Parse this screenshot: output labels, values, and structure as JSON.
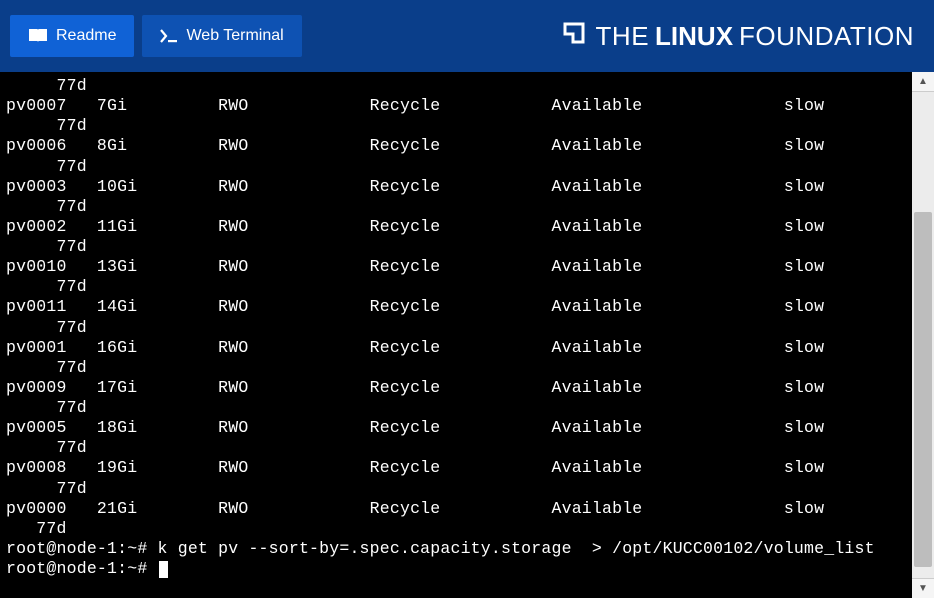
{
  "header": {
    "readme_label": "Readme",
    "webterm_label": "Web Terminal",
    "brand_prefix": "THE",
    "brand_bold": "LINUX",
    "brand_suffix": "FOUNDATION"
  },
  "terminal": {
    "age_indent": "     77d",
    "rows": [
      {
        "name": "pv0007",
        "cap": "7Gi",
        "access": "RWO",
        "reclaim": "Recycle",
        "status": "Available",
        "class": "slow"
      },
      {
        "name": "pv0006",
        "cap": "8Gi",
        "access": "RWO",
        "reclaim": "Recycle",
        "status": "Available",
        "class": "slow"
      },
      {
        "name": "pv0003",
        "cap": "10Gi",
        "access": "RWO",
        "reclaim": "Recycle",
        "status": "Available",
        "class": "slow"
      },
      {
        "name": "pv0002",
        "cap": "11Gi",
        "access": "RWO",
        "reclaim": "Recycle",
        "status": "Available",
        "class": "slow"
      },
      {
        "name": "pv0010",
        "cap": "13Gi",
        "access": "RWO",
        "reclaim": "Recycle",
        "status": "Available",
        "class": "slow"
      },
      {
        "name": "pv0011",
        "cap": "14Gi",
        "access": "RWO",
        "reclaim": "Recycle",
        "status": "Available",
        "class": "slow"
      },
      {
        "name": "pv0001",
        "cap": "16Gi",
        "access": "RWO",
        "reclaim": "Recycle",
        "status": "Available",
        "class": "slow"
      },
      {
        "name": "pv0009",
        "cap": "17Gi",
        "access": "RWO",
        "reclaim": "Recycle",
        "status": "Available",
        "class": "slow"
      },
      {
        "name": "pv0005",
        "cap": "18Gi",
        "access": "RWO",
        "reclaim": "Recycle",
        "status": "Available",
        "class": "slow"
      },
      {
        "name": "pv0008",
        "cap": "19Gi",
        "access": "RWO",
        "reclaim": "Recycle",
        "status": "Available",
        "class": "slow"
      },
      {
        "name": "pv0000",
        "cap": "21Gi",
        "access": "RWO",
        "reclaim": "Recycle",
        "status": "Available",
        "class": "slow"
      }
    ],
    "prompt": "root@node-1:~#",
    "cmd1": "k get pv --sort-by=.spec.capacity.storage  > /opt/KUCC00102/volume_list"
  }
}
